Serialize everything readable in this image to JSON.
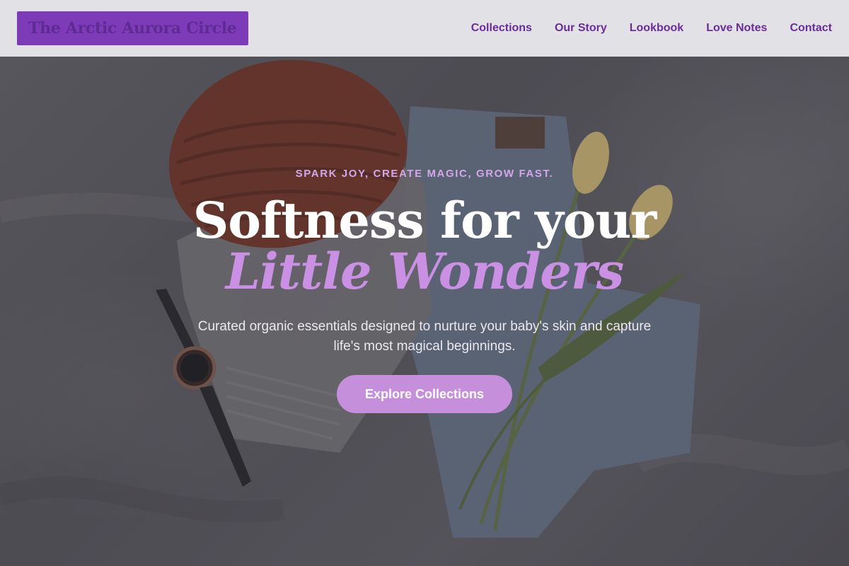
{
  "header": {
    "brand": "The Arctic Aurora Circle",
    "nav": [
      {
        "label": "Collections"
      },
      {
        "label": "Our Story"
      },
      {
        "label": "Lookbook"
      },
      {
        "label": "Love Notes"
      },
      {
        "label": "Contact"
      }
    ]
  },
  "hero": {
    "tagline": "SPARK JOY, CREATE MAGIC, GROW FAST.",
    "headline_line1": "Softness for your",
    "headline_line2": "Little Wonders",
    "subtext": "Curated organic essentials designed to nurture your baby's skin and capture life's most magical beginnings.",
    "cta_label": "Explore Collections",
    "background_image": "flat-lay of knit beanie, sweater, jeans, wristwatch and tulips on bedsheet"
  },
  "colors": {
    "brand_purple": "#7e3bb8",
    "nav_text": "#6a2c9a",
    "accent_lilac": "#c990e3",
    "cta_bg": "#c58fdc",
    "header_bg": "#e8e8ec"
  }
}
